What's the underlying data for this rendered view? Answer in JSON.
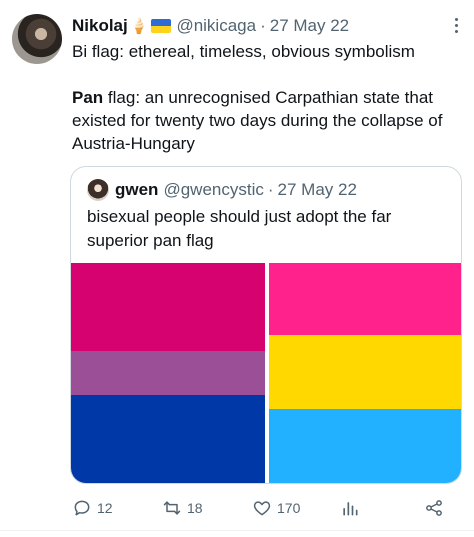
{
  "tweet": {
    "author": {
      "name": "Nikolaj",
      "emoji": "🍦",
      "handle": "@nikicaga",
      "separator": "·",
      "date": "27 May 22"
    },
    "text": {
      "line1": "Bi flag: ethereal, timeless, obvious symbolism",
      "pan_bold": "Pan",
      "pan_rest": " flag: an unrecognised Carpathian state that existed for twenty two days during the collapse of Austria-Hungary"
    },
    "quote": {
      "name": "gwen",
      "handle": "@gwencystic",
      "separator": "·",
      "date": "27 May 22",
      "text": "bisexual people should just adopt the far superior pan flag",
      "images": {
        "bi_flag_colors": [
          "#d60270",
          "#9b4f96",
          "#0038a8"
        ],
        "pan_flag_colors": [
          "#ff218c",
          "#ffd800",
          "#21b1ff"
        ]
      }
    },
    "actions": {
      "replies": "12",
      "retweets": "18",
      "likes": "170"
    }
  },
  "icons": [
    "more-icon",
    "reply-icon",
    "retweet-icon",
    "like-icon",
    "views-icon",
    "share-icon"
  ],
  "colors": {
    "text": "#0f1419",
    "secondary": "#536471",
    "border": "#cfd9de"
  }
}
